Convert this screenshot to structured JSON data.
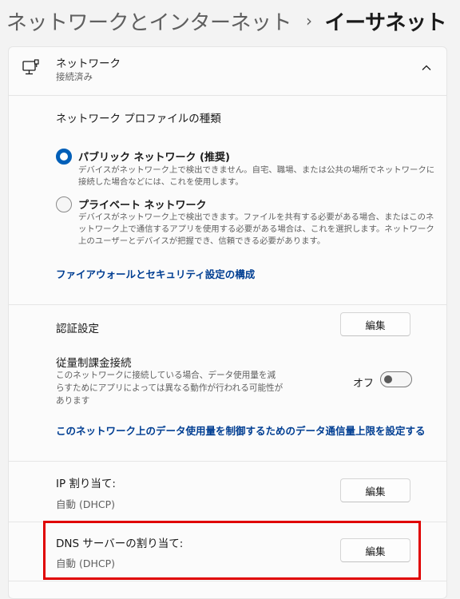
{
  "breadcrumb": {
    "parent": "ネットワークとインターネット",
    "separator": "›",
    "current": "イーサネット"
  },
  "network_card": {
    "icon": "wired-network-icon",
    "title": "ネットワーク",
    "status": "接続済み",
    "collapse_icon": "chevron-up-icon"
  },
  "profile": {
    "title": "ネットワーク プロファイルの種類",
    "options": [
      {
        "label": "パブリック ネットワーク (推奨)",
        "description": "デバイスがネットワーク上で検出できません。自宅、職場、または公共の場所でネットワークに接続した場合などには、これを使用します。",
        "selected": true
      },
      {
        "label": "プライベート ネットワーク",
        "description": "デバイスがネットワーク上で検出できます。ファイルを共有する必要がある場合、またはこのネットワーク上で通信するアプリを使用する必要がある場合は、これを選択します。ネットワーク上のユーザーとデバイスが把握でき、信頼できる必要があります。",
        "selected": false
      }
    ],
    "firewall_link": "ファイアウォールとセキュリティ設定の構成"
  },
  "auth": {
    "label": "認証設定",
    "button": "編集"
  },
  "metered": {
    "label": "従量制課金接続",
    "description": "このネットワークに接続している場合、データ使用量を減らすためにアプリによっては異なる動作が行われる可能性があります",
    "state": "オフ",
    "enabled": false,
    "data_limit_link": "このネットワーク上のデータ使用量を制御するためのデータ通信量上限を設定する"
  },
  "ip": {
    "label": "IP 割り当て:",
    "value": "自動 (DHCP)",
    "button": "編集"
  },
  "dns": {
    "label": "DNS サーバーの割り当て:",
    "value": "自動 (DHCP)",
    "button": "編集"
  },
  "colors": {
    "accent": "#005fb8",
    "link": "#003e92",
    "highlight": "#e00000"
  }
}
